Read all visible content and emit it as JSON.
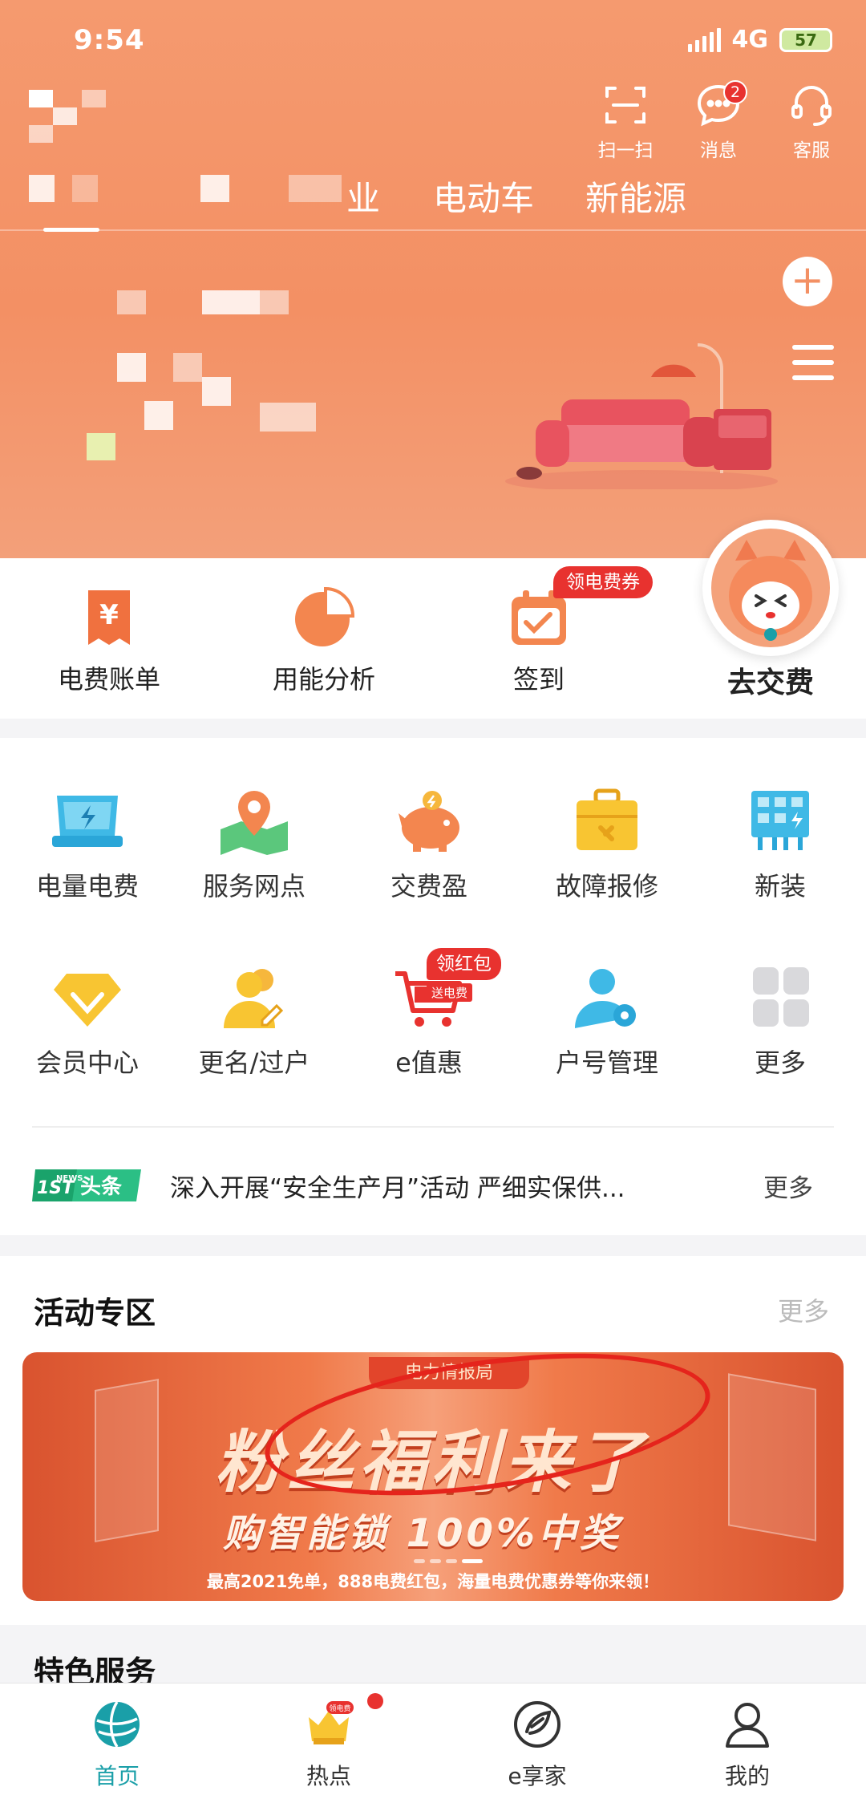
{
  "status_bar": {
    "time": "9:54",
    "network": "4G",
    "battery": "57"
  },
  "top_tools": [
    {
      "name": "scan",
      "label": "扫一扫",
      "icon": "scan-icon"
    },
    {
      "name": "messages",
      "label": "消息",
      "icon": "chat-bubble-icon",
      "badge": "2"
    },
    {
      "name": "service",
      "label": "客服",
      "icon": "headset-icon"
    }
  ],
  "channel_tabs": [
    "业",
    "电动车",
    "新能源"
  ],
  "quick_actions": [
    {
      "label": "电费账单",
      "icon": "yuan-bill-icon"
    },
    {
      "label": "用能分析",
      "icon": "pie-chart-icon"
    },
    {
      "label": "签到",
      "icon": "calendar-check-icon",
      "tag": "领电费券"
    }
  ],
  "pay_button": {
    "label": "去交费",
    "icon": "mascot-icon"
  },
  "services": [
    {
      "label": "电量电费",
      "icon": "meter-icon"
    },
    {
      "label": "服务网点",
      "icon": "map-pin-icon"
    },
    {
      "label": "交费盈",
      "icon": "piggy-bank-icon"
    },
    {
      "label": "故障报修",
      "icon": "toolbox-icon"
    },
    {
      "label": "新装",
      "icon": "solar-panel-icon"
    },
    {
      "label": "会员中心",
      "icon": "diamond-icon"
    },
    {
      "label": "更名/过户",
      "icon": "user-edit-icon"
    },
    {
      "label": "e值惠",
      "icon": "shopping-cart-icon",
      "tag": "领红包",
      "subtag": "送电费"
    },
    {
      "label": "户号管理",
      "icon": "user-gear-icon"
    },
    {
      "label": "更多",
      "icon": "grid-icon"
    }
  ],
  "news": {
    "logo_badge": "1ST",
    "logo_small": "NEWS",
    "logo_text": "头条",
    "headline": "深入开展“安全生产月”活动 严细实保供...",
    "more": "更多"
  },
  "activity": {
    "title": "活动专区",
    "more": "更多",
    "banner_tag": "电力情报局",
    "banner_main": "粉丝福利来了",
    "banner_sub": "购智能锁  100%中奖",
    "banner_foot": "最高2021免单，888电费红包，海量电费优惠券等你来领！"
  },
  "special": {
    "title": "特色服务"
  },
  "bottom_nav": [
    {
      "label": "首页",
      "icon": "globe-icon",
      "active": true
    },
    {
      "label": "热点",
      "icon": "crown-gift-icon",
      "tag": "领电费"
    },
    {
      "label": "e享家",
      "icon": "leaf-e-icon"
    },
    {
      "label": "我的",
      "icon": "user-icon"
    }
  ],
  "colors": {
    "primary": "#f39064",
    "accent_red": "#e8322f",
    "active_nav": "#1a9fa8"
  }
}
